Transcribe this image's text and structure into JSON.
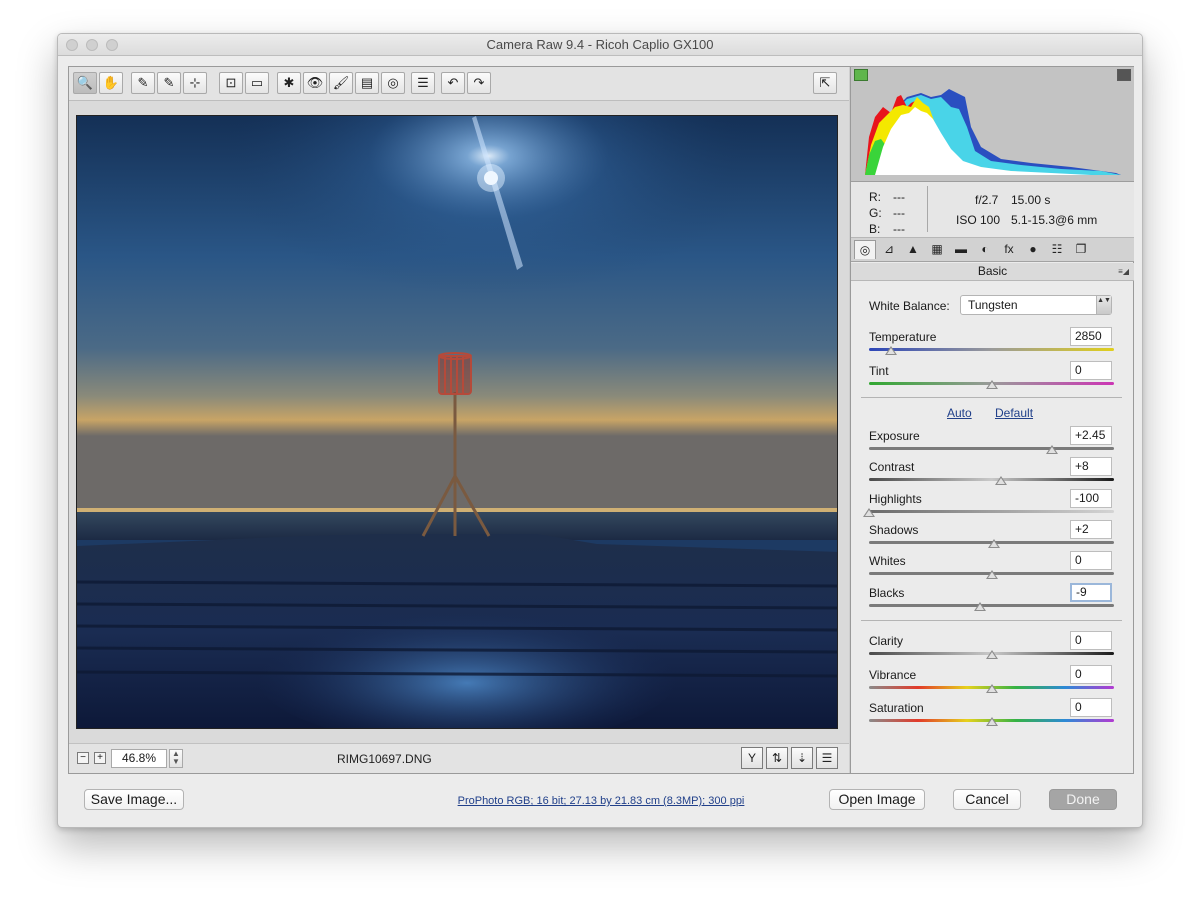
{
  "window": {
    "title": "Camera Raw 9.4  -  Ricoh Caplio GX100"
  },
  "toolbar": {
    "tools": [
      "zoom-tool",
      "hand-tool",
      "white-balance-tool",
      "color-sampler-tool",
      "targeted-adjustment-tool",
      "crop-tool",
      "straighten-tool",
      "spot-removal-tool",
      "red-eye-removal-tool",
      "adjustment-brush",
      "graduated-filter",
      "radial-filter",
      "open-preferences",
      "rotate-left",
      "rotate-right"
    ],
    "glyphs": [
      "🔍",
      "✋",
      "✎",
      "✎",
      "⊹",
      "⊡",
      "▭",
      "✱",
      "👁",
      "🖌",
      "▤",
      "◎",
      "☰",
      "↶",
      "↷"
    ],
    "toggle_fullscreen_glyph": "⇱"
  },
  "status": {
    "zoom": "46.8%",
    "filename": "RIMG10697.DNG",
    "icons": [
      "Y",
      "⇅",
      "⇣",
      "☰"
    ]
  },
  "histogram": {
    "colors": {
      "red": "#e8141c",
      "green": "#39d43a",
      "blue": "#2a4fc0",
      "yellow": "#f4e800",
      "cyan": "#49d4e8",
      "white": "#ffffff"
    }
  },
  "readout": {
    "r_label": "R:",
    "r_value": "---",
    "g_label": "G:",
    "g_value": "---",
    "b_label": "B:",
    "b_value": "---",
    "aperture": "f/2.7",
    "shutter": "15.00 s",
    "iso": "ISO 100",
    "lens": "5.1-15.3@6 mm"
  },
  "panel_tabs": [
    "◎",
    "⊿",
    "▲",
    "▦",
    "▬",
    "◐",
    "fx",
    "●",
    "☷",
    "❐"
  ],
  "panel": {
    "title": "Basic",
    "menu_glyph": "≡◢",
    "white_balance_label": "White Balance:",
    "white_balance_value": "Tungsten",
    "select_glyph": "▲▼",
    "auto_label": "Auto",
    "default_label": "Default",
    "sliders": [
      {
        "id": "temperature",
        "label": "Temperature",
        "value": "2850",
        "position": 0.09
      },
      {
        "id": "tint",
        "label": "Tint",
        "value": "0",
        "position": 0.5
      },
      {
        "id": "exposure",
        "label": "Exposure",
        "value": "+2.45",
        "position": 0.745
      },
      {
        "id": "contrast",
        "label": "Contrast",
        "value": "+8",
        "position": 0.54
      },
      {
        "id": "highlights",
        "label": "Highlights",
        "value": "-100",
        "position": 0.0
      },
      {
        "id": "shadows",
        "label": "Shadows",
        "value": "+2",
        "position": 0.51
      },
      {
        "id": "whites",
        "label": "Whites",
        "value": "0",
        "position": 0.5
      },
      {
        "id": "blacks",
        "label": "Blacks",
        "value": "-9",
        "position": 0.455
      },
      {
        "id": "clarity",
        "label": "Clarity",
        "value": "0",
        "position": 0.5
      },
      {
        "id": "vibrance",
        "label": "Vibrance",
        "value": "0",
        "position": 0.5
      },
      {
        "id": "saturation",
        "label": "Saturation",
        "value": "0",
        "position": 0.5
      }
    ]
  },
  "footer": {
    "save_label": "Save Image...",
    "info_link": "ProPhoto RGB; 16 bit; 27.13 by 21.83 cm (8.3MP); 300 ppi",
    "open_label": "Open Image",
    "cancel_label": "Cancel",
    "done_label": "Done"
  }
}
